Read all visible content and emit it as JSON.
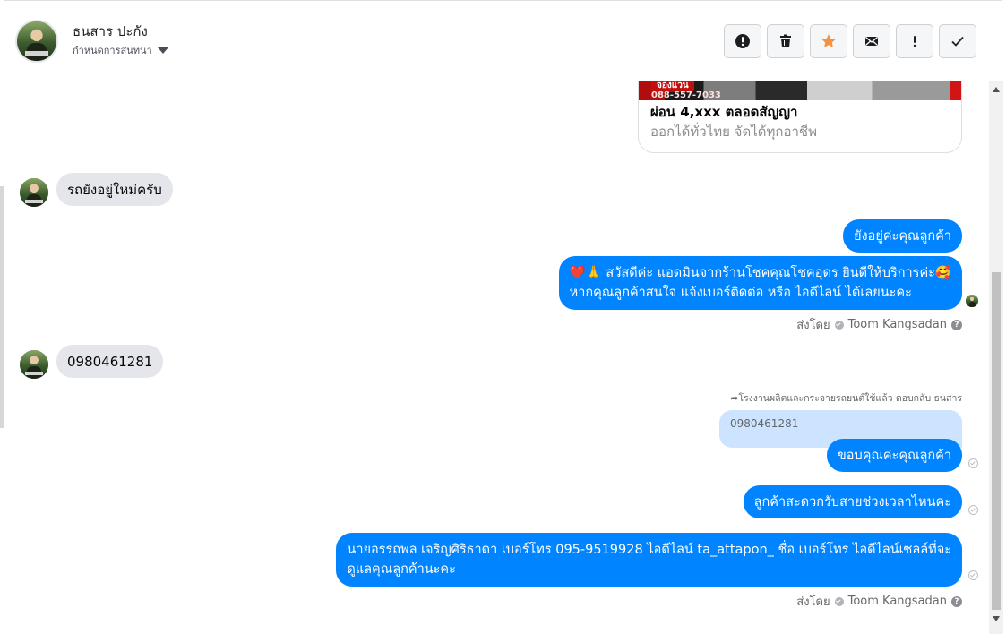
{
  "header": {
    "name": "ธนสาร ปะกัง",
    "subtitle": "กำหนดการสนทนา",
    "actions": [
      {
        "name": "spam",
        "icon": "alert-circle-icon"
      },
      {
        "name": "delete",
        "icon": "trash-icon"
      },
      {
        "name": "star",
        "icon": "star-icon"
      },
      {
        "name": "mail",
        "icon": "envelope-icon"
      },
      {
        "name": "important",
        "icon": "exclamation-icon"
      },
      {
        "name": "done",
        "icon": "check-icon"
      }
    ],
    "colors": {
      "star": "#f7923b"
    }
  },
  "card": {
    "image_tag": "จองแวน",
    "image_number": "088-557-7033",
    "title": "ผ่อน 4,xxx ตลอดสัญญา",
    "subtitle": "ออกได้ทั่วไทย จัดได้ทุกอาชีพ"
  },
  "messages": {
    "in1": "รถยังอยู่ใหม่ครับ",
    "out1": "ยังอยู่ค่ะคุณลูกค้า",
    "out2_line1": "❤️🙏 สวัสดีค่ะ แอดมินจากร้านโชคคุณโชคอุดร ยินดีให้บริการค่ะ🥰",
    "out2_line2": "หากคุณลูกค้าสนใจ แจ้งเบอร์ติดต่อ หรือ ไอดีไลน์ ได้เลยนะคะ",
    "sent_by_label": "ส่งโดย",
    "sent_by_name": "Toom Kangsadan",
    "in2": "0980461281",
    "reply_header": "โรงงานผลิตและกระจายรถยนต์ใช้แล้ว ตอบกลับ ธนสาร",
    "quoted": "0980461281",
    "out3": "ขอบคุณค่ะคุณลูกค้า",
    "out4": "ลูกค้าสะดวกรับสายช่วงเวลาไหนคะ",
    "out5_line1": "นายอรรถพล เจริญศิริธาดา      เบอร์โทร 095-9519928 ไอดีไลน์ ta_attapon_ ชื่อ เบอร์โทร ไอดีไลน์เซลล์ที่จะ",
    "out5_line2": "ดูแลคุณลูกค้านะคะ",
    "sent_by_label_2": "ส่งโดย",
    "sent_by_name_2": "Toom Kangsadan"
  },
  "colors": {
    "outgoing": "#0084ff",
    "incoming": "#e4e6eb",
    "quoted": "#cce4ff"
  }
}
